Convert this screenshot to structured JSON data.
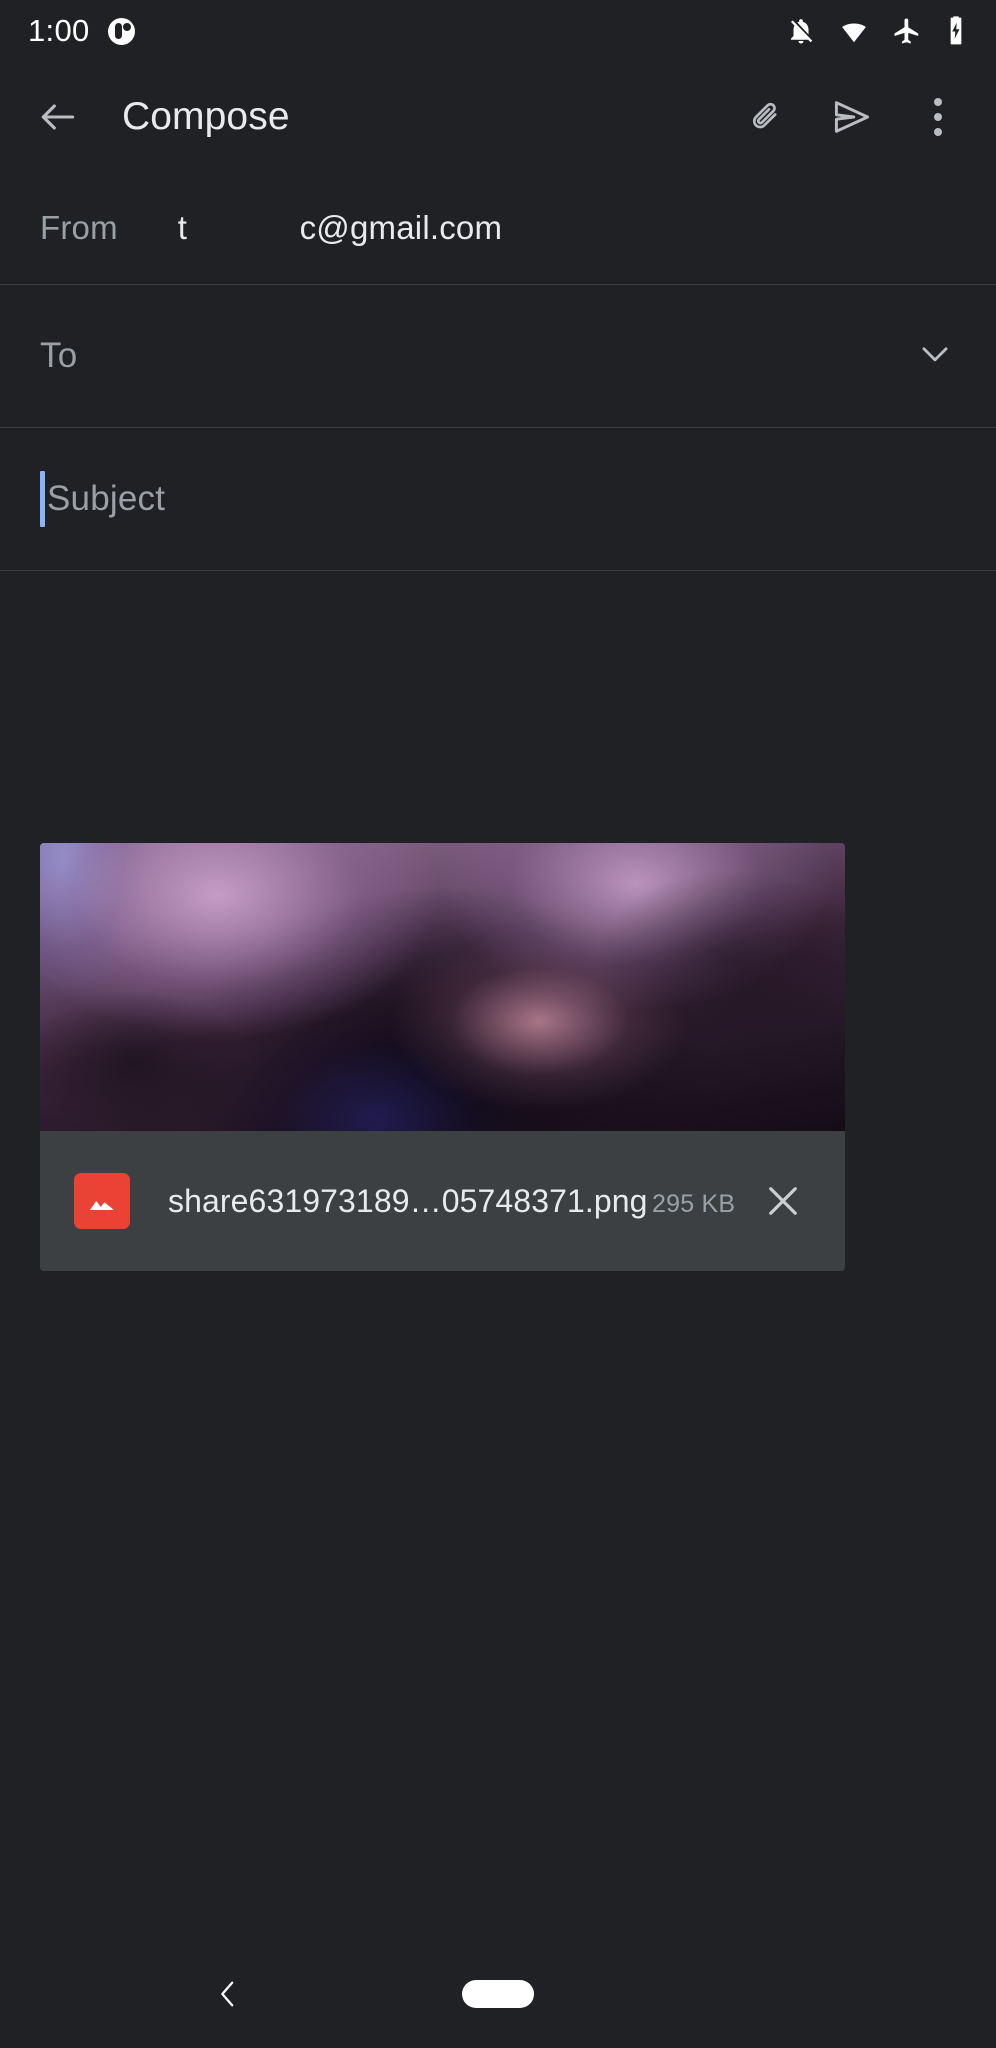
{
  "status_bar": {
    "time": "1:00",
    "icons": [
      {
        "name": "app-notification-icon"
      },
      {
        "name": "notifications-off-icon"
      },
      {
        "name": "wifi-icon"
      },
      {
        "name": "airplane-mode-icon"
      },
      {
        "name": "battery-charging-icon"
      }
    ]
  },
  "app_bar": {
    "back_label": "back-arrow",
    "title": "Compose",
    "attach_label": "attach-file",
    "send_label": "send",
    "more_label": "more-options"
  },
  "compose": {
    "from_label": "From",
    "from_value": "t            c@gmail.com",
    "to_placeholder": "To",
    "to_value": "",
    "expand_label": "show-cc-bcc",
    "subject_placeholder": "Subject",
    "subject_value": "",
    "body_placeholder": "",
    "body_value": ""
  },
  "attachment": {
    "file_name": "share631973189…05748371.png",
    "file_size": "295 KB",
    "file_type_icon": "image-icon",
    "remove_label": "remove-attachment"
  },
  "nav_bar": {
    "back_label": "system-back",
    "home_label": "home-pill"
  },
  "colors": {
    "background": "#202124",
    "surface": "#3c4043",
    "divider": "#3a3c3f",
    "text_primary": "#e8eaed",
    "text_secondary": "#9aa0a6",
    "accent_caret": "#8ab4f8",
    "file_icon": "#ea4335"
  }
}
